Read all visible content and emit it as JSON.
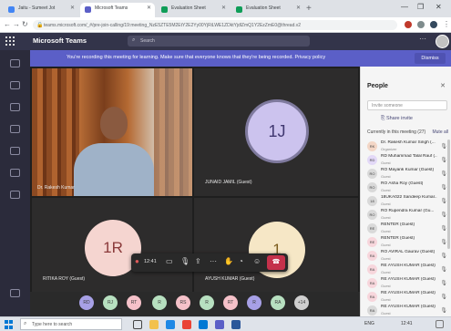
{
  "browser": {
    "tabs": [
      {
        "label": "Jaitu - Sumeet Jot",
        "active": false
      },
      {
        "label": "Microsoft Teams",
        "active": true
      },
      {
        "label": "Evaluation Sheet",
        "active": false
      },
      {
        "label": "Evaluation Sheet",
        "active": false
      }
    ],
    "url": "teams.microsoft.com/_#/pre-join-calling/19:meeting_NzE5ZTE5M2EtY2E2Yy00YjRiLWE1ZDktYjdlZmQ1Y2EzZmE0@thread.v2"
  },
  "teams": {
    "app_title": "Microsoft Teams",
    "search_placeholder": "Search"
  },
  "banner": {
    "text": "You're recording this meeting for learning. Make sure that everyone knows that they're being recorded. Privacy policy",
    "dismiss_label": "Dismiss"
  },
  "stage": {
    "tiles": [
      {
        "label": "Dr. Rakesh Kumar",
        "type": "video"
      },
      {
        "label": "JUNAID JAMIL (Guest)",
        "initials": "1J"
      },
      {
        "label": "RITIKA ROY (Guest)",
        "initials": "1R"
      },
      {
        "label": "AYUSH KUMAR (Guest)",
        "initials": "1"
      }
    ],
    "call_time": "12:41"
  },
  "people_panel": {
    "title": "People",
    "invite_placeholder": "Invite someone",
    "share_invite_label": "Share invite",
    "section_header": "Currently in this meeting (27)",
    "mute_all_label": "Mute all",
    "participants": [
      {
        "name": "Dr. Rakesh Kumar Singh (...",
        "role": "Organizer",
        "initials": "RK",
        "color": "#f3d6c6"
      },
      {
        "name": "RD Muhammad Talal Rauf (...",
        "role": "Guest",
        "initials": "RD",
        "color": "#e3d9f7"
      },
      {
        "name": "RO Mayank Kumar (Guest)",
        "role": "Guest",
        "initials": "RO",
        "color": "#d9d9d9"
      },
      {
        "name": "RO Asha Roy (Guest)",
        "role": "Guest",
        "initials": "RO",
        "color": "#d9d9d9"
      },
      {
        "name": "18UKA022 Sandeep Kumar...",
        "role": "Guest",
        "initials": "18",
        "color": "#d9d9d9"
      },
      {
        "name": "RO Rupendra Kumar (Gu...",
        "role": "Guest",
        "initials": "RO",
        "color": "#d9d9d9"
      },
      {
        "name": "RENTER (Guest)",
        "role": "Guest",
        "initials": "RE",
        "color": "#d9d9d9"
      },
      {
        "name": "RENTER (Guest)",
        "role": "Guest",
        "initials": "RE",
        "color": "#f7d6dc"
      },
      {
        "name": "RO AVIRAL Gaurav (Guest)",
        "role": "Guest",
        "initials": "RA",
        "color": "#f7d6dc"
      },
      {
        "name": "RE AYUSH KUMAR (Guest)",
        "role": "Guest",
        "initials": "RA",
        "color": "#f7d6dc"
      },
      {
        "name": "RE AYUSH KUMAR (Guest)",
        "role": "Guest",
        "initials": "RA",
        "color": "#f7d6dc"
      },
      {
        "name": "RE AYUSH KUMAR (Guest)",
        "role": "Guest",
        "initials": "RA",
        "color": "#f7d6dc"
      },
      {
        "name": "RE AYUSH KUMAR (Guest)",
        "role": "Guest",
        "initials": "RA",
        "color": "#d9d9d9"
      }
    ]
  },
  "strip": {
    "bubbles": [
      {
        "initials": "RD",
        "color": "#a7a0e6"
      },
      {
        "initials": "RJ",
        "color": "#b7e0c0"
      },
      {
        "initials": "RT",
        "color": "#f5c1c9"
      },
      {
        "initials": "R",
        "color": "#b7e0c0"
      },
      {
        "initials": "RS",
        "color": "#f5c1c9"
      },
      {
        "initials": "R",
        "color": "#b7e0c0"
      },
      {
        "initials": "RT",
        "color": "#f5c1c9"
      },
      {
        "initials": "R",
        "color": "#a7a0e6"
      },
      {
        "initials": "RA",
        "color": "#b7e0c0"
      },
      {
        "initials": "+14",
        "color": "#cfcfcf"
      }
    ]
  },
  "taskbar": {
    "search_placeholder": "Type here to search",
    "tray_text": "ENG",
    "clock": "12:41"
  },
  "colors": {
    "teams_header": "#33344a",
    "banner": "#5b5fc7",
    "hangup": "#c4314b"
  }
}
